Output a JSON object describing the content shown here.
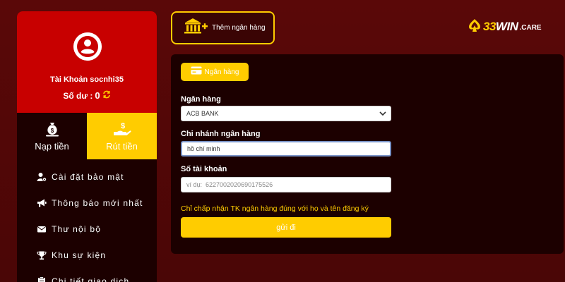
{
  "sidebar": {
    "account_label": "Tài Khoản socnhi35",
    "balance_label": "Số dư :",
    "balance_value": "0",
    "tabs": [
      {
        "label": "Nạp tiền",
        "icon": "money-bag-icon"
      },
      {
        "label": "Rút tiền",
        "icon": "hand-dollar-icon"
      }
    ],
    "menu": [
      {
        "label": "Cài đặt bảo mật",
        "icon": "user-gear-icon"
      },
      {
        "label": "Thông báo mới nhất",
        "icon": "megaphone-icon"
      },
      {
        "label": "Thư nội bộ",
        "icon": "envelope-icon"
      },
      {
        "label": "Khu sự kiện",
        "icon": "trophy-icon"
      },
      {
        "label": "Chi tiết giao dịch",
        "icon": "clipboard-icon"
      }
    ]
  },
  "header": {
    "add_bank_label": "Thêm ngân hàng",
    "logo": {
      "brand_a": "33",
      "brand_b": "WIN",
      "suffix": ".CARE"
    }
  },
  "form": {
    "chip_label": "Ngân hàng",
    "bank_label": "Ngân hàng",
    "bank_selected": "ACB BANK",
    "branch_label": "Chi nhánh ngân hàng",
    "branch_value": "hồ chí minh",
    "account_label": "Số tài khoản",
    "account_placeholder": "ví dụ:  6227002020690175526",
    "notice": "Chỉ chấp nhận TK ngân hàng đúng với họ và tên đăng ký",
    "submit_label": "gửi đi"
  },
  "colors": {
    "accent": "#ffcc00",
    "profile_bg": "#c80000",
    "panel_bg": "#1c0000",
    "page_bg": "#5a0808"
  }
}
